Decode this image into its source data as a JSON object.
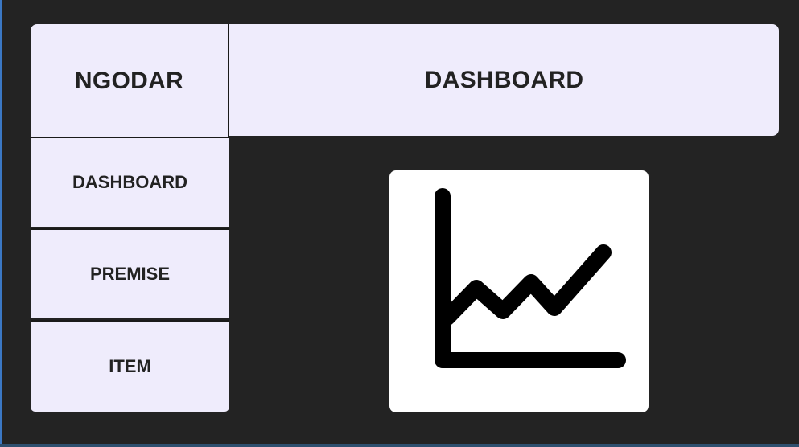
{
  "brand": {
    "name": "NGODAR"
  },
  "header": {
    "title": "DASHBOARD"
  },
  "sidebar": {
    "items": [
      {
        "label": "DASHBOARD"
      },
      {
        "label": "PREMISE"
      },
      {
        "label": "ITEM"
      }
    ]
  },
  "main": {
    "tile_icon": "line-chart-icon"
  },
  "colors": {
    "background": "#232323",
    "panel": "#efecfc",
    "text": "#222222",
    "tile": "#ffffff",
    "icon": "#000000"
  }
}
